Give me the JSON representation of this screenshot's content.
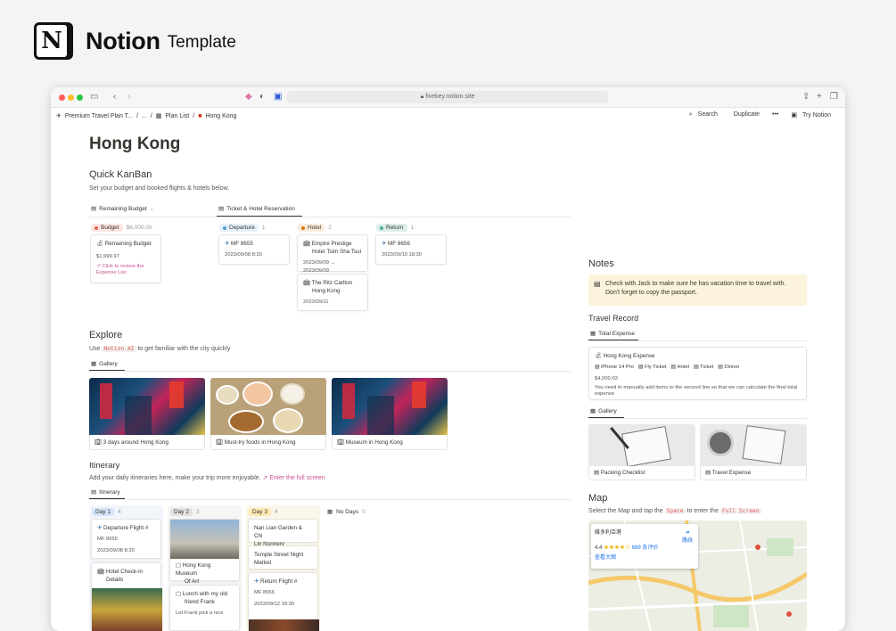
{
  "header": {
    "logo_letter": "N",
    "brand": "Notion",
    "subtitle": "Template"
  },
  "browser": {
    "url": "fivekey.notion.site"
  },
  "breadcrumb": {
    "items": [
      "Premium Travel Plan T...",
      "/",
      "...",
      "/",
      "Plan List",
      "/",
      "Hong Kong"
    ]
  },
  "toolbar": {
    "search": "Search",
    "duplicate": "Duplicate",
    "more": "•••",
    "try": "Try Notion"
  },
  "page": {
    "title": "Hong Kong"
  },
  "kanban": {
    "heading": "Quick KanBan",
    "desc": "Set your budget and booked flights & hotels below.",
    "tab1": "Remaining Budget",
    "tab2": "Ticket & Hotel Reservation",
    "budget_label": "Budget",
    "budget_value": "$6,000.00",
    "budget_card_title": "Remaining Budget",
    "budget_card_value": "$1,999.97",
    "budget_card_link1": "Click to review the",
    "budget_card_link2": "Expense List",
    "departure": {
      "label": "Departure",
      "count": "1",
      "card_title": "MF 8655",
      "card_date": "2023/09/08 8:20"
    },
    "hotel": {
      "label": "Hotel",
      "count": "2",
      "card1_l1": "Empire Prestige",
      "card1_l2": "Hotel Tsim Sha Tsui",
      "card1_date": "2023/09/09 → 2023/09/09",
      "card2_l1": "The Ritz Carlton",
      "card2_l2": "Hong Kong",
      "card2_date": "2023/09/11"
    },
    "return": {
      "label": "Return",
      "count": "1",
      "card_title": "MF 8656",
      "card_date": "2023/09/10 18:30"
    }
  },
  "explore": {
    "heading": "Explore",
    "desc_pre": "Use",
    "desc_code": "Notion AI",
    "desc_post": "to get familiar with the city quickly",
    "tab": "Gallery",
    "cards": [
      "3 days around Hong Kong",
      "Must-try foods in Hong Kong",
      "Museum in Hong Kong"
    ]
  },
  "itinerary": {
    "heading": "Itinerary",
    "desc": "Add your daily itineraries here, make your trip more enjoyable.",
    "link": "Enter the full screen",
    "tab": "Itinerary",
    "day1": {
      "label": "Day 1",
      "count": "4",
      "c1": "Departure Flight #",
      "c1_sub": "MF 8655",
      "c1_date": "2023/09/08 8:20",
      "c2_l1": "Hotel Check-in",
      "c2_l2": "Details"
    },
    "day2": {
      "label": "Day 2",
      "count": "3",
      "c1_l1": "Hong Kong Museum",
      "c1_l2": "Of Art",
      "c2_l1": "Lunch with my old",
      "c2_l2": "friend Frank",
      "c2_sub": "Let Frank pick a nice"
    },
    "day3": {
      "label": "Day 3",
      "count": "4",
      "c1_l1": "Nan Lian Garden & Chi",
      "c1_l2": "Lin Nunnery",
      "c2_l1": "Temple Street Night",
      "c2_l2": "Market",
      "c3": "Return Flight #",
      "c3_sub": "MF 8656",
      "c3_date": "2023/09/12 18:30"
    },
    "nodays": {
      "label": "No Days",
      "count": "0"
    }
  },
  "notes": {
    "heading": "Notes",
    "line1": "Check with Jack to make sure he has vacation time to travel with.",
    "line2": "Don't forget to copy the passport."
  },
  "travel_record": {
    "heading": "Travel Record",
    "tab": "Total Expense",
    "card_title": "Hong Kong Expense",
    "tags": [
      "iPhone 14 Pro",
      "Fly Ticket",
      "Hotel",
      "Ticket",
      "Dinner"
    ],
    "amount": "$4,000.03",
    "note1": "You need to manually add items to the second line so that we can calculate the final total",
    "note2": "expense",
    "gallery_tab": "Gallery",
    "g1": "Packing Checklist",
    "g2": "Travel Expense"
  },
  "map": {
    "heading": "Map",
    "desc_pre": "Select the Map and tap the",
    "code1": "Space",
    "desc_mid": "to enter the",
    "code2": "Full Screen",
    "place": "維多利亞港",
    "rating": "4.4",
    "stars": "★★★★☆",
    "reviews": "689 条评价",
    "bigger": "查看大图",
    "route": "路线"
  }
}
